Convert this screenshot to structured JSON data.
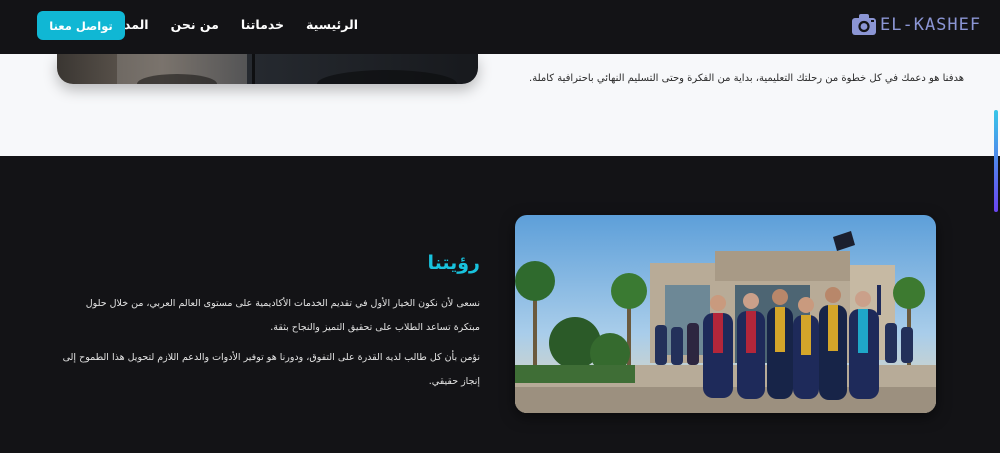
{
  "header": {
    "logo_text": "EL-KASHEF",
    "nav": [
      {
        "label": "الرئيسية"
      },
      {
        "label": "خدماتنا"
      },
      {
        "label": "من نحن"
      },
      {
        "label": "المدونة"
      }
    ],
    "cta_label": "تواصل معنا"
  },
  "about": {
    "text": "هدفنا هو دعمك في كل خطوة من رحلتك التعليمية، بداية من الفكرة وحتى التسليم النهائي باحترافية كاملة."
  },
  "vision": {
    "title": "رؤيتنا",
    "paragraph1": "نسعى لأن نكون الخيار الأول في تقديم الخدمات الأكاديمية على مستوى العالم العربي، من خلال حلول مبتكرة تساعد الطلاب على تحقيق التميز والنجاح بثقة.",
    "paragraph2": "نؤمن بأن كل طالب لديه القدرة على التفوق، ودورنا هو توفير الأدوات والدعم اللازم لتحويل هذا الطموح إلى إنجاز حقيقي."
  },
  "colors": {
    "accent": "#10b7d4",
    "title": "#18c2dd",
    "logo": "#8b95d4",
    "dark_bg": "#131316",
    "light_bg": "#f7f8fa"
  },
  "icons": {
    "logo": "camera-icon"
  }
}
